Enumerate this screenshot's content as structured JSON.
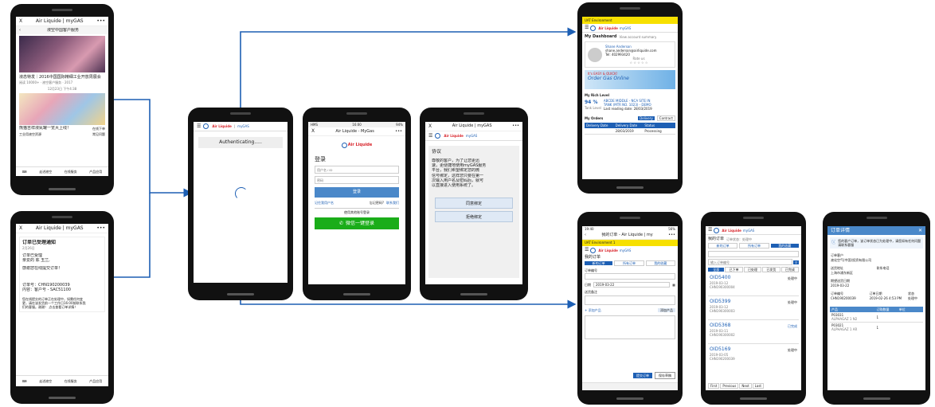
{
  "phone_wechat_news": {
    "close": "X",
    "title": "Air Liquide | myGAS",
    "more": "•••",
    "back": "‹",
    "header": "液空中国客户服务",
    "article1": "液态特发｜2016中国国际精细工业开放周展会",
    "article1_meta": "阅读 10000+ · 液空客户服务 · 2017",
    "date_sep": "12月23日 下午4:38",
    "article2a": "熊猫吉祥液氮罐一览大上线！",
    "article2b": "在线下单",
    "article2c": "工业用液空资源",
    "article2d": "常见问题",
    "nav1": "走进液空",
    "nav2": "在线服务",
    "nav3": "产品应用"
  },
  "phone_wechat_notice": {
    "close": "X",
    "title": "Air Liquide | myGAS",
    "more": "•••",
    "notice_title": "订单已受理通知",
    "notice_date": "2月26日",
    "p1": "订单已受理",
    "p2": "亲爱的 陈 玉兰,",
    "p3": "感谢您在线提交订单！",
    "p4": "订单号：CHN190200039",
    "p5": "内容：客户号 - SAC51100",
    "p6": "您在线提交的订单正在处理中，如需任何变",
    "p7": "更，请在该发货前一个工作日16:00前联系我",
    "p8": "们的客服。谢谢！ 点击查看订单详情！",
    "nav1": "走进液空",
    "nav2": "在线服务",
    "nav3": "产品应用"
  },
  "phone_auth": {
    "brand": "Air Liquide",
    "sep": "|",
    "app": "myGAS",
    "status": "Authenticating....."
  },
  "phone_login": {
    "status_left": "HMS",
    "status_time": "16:00",
    "status_right": "94%",
    "close": "X",
    "title": "Air Liquide - MyGas",
    "more": "•••",
    "brand": "Air Liquide",
    "heading": "登录",
    "user_placeholder": "用户名 / ID",
    "pass_placeholder": "密码",
    "login_button": "登录",
    "remember": "记住我用户名",
    "forgot": "忘记密码?",
    "help": "联系我们",
    "other_login": "使用其他账号登录",
    "wechat_login": "微信一键登录"
  },
  "phone_agreement": {
    "close": "X",
    "title": "Air Liquide | myGAS",
    "more": "•••",
    "brand": "Air Liquide",
    "app": "myGAS",
    "heading": "协议",
    "line1": "尊敬的客户，为了让您更迅",
    "line2": "速，更便捷地使用myGAS服务",
    "line3": "平台，我们希望绑定您的微",
    "line4": "信号绑定，这样您只要在第一",
    "line5": "次输入用户名及密码后，就可",
    "line6": "以直接进入使用系统了。",
    "agree": "同意绑定",
    "refuse": "拒绝绑定"
  },
  "phone_dashboard": {
    "banner": "UAT Environment",
    "brand": "Air Liquide",
    "app": "myGAS",
    "page_title": "My Dashboard",
    "view_link": "View account summary",
    "user_name": "Shane Anderson",
    "user_email": "shane.anderson@airliquide.com",
    "user_tel": "Tel: 402993420",
    "rate_label": "Rate us",
    "rate_stars": "☆ ☆ ☆ ☆ ☆",
    "promo_line1": "It's EASY & QUICK!",
    "promo_line2": "Order Gas Online",
    "rich_level": "My Rich Level",
    "level_pct": "94 %",
    "level_caption": "Tank Level",
    "level_desc1": "ABCDE MIDDLE - NCA SITE IN",
    "level_desc2": "TANK (MTR NO. 1023) - DEMO",
    "level_desc3": "Last reading date: 28/03/2019",
    "orders_title": "My Orders",
    "tab_delivery": "Delivery",
    "tab_contract": "Contract",
    "col1": "Delivery Date",
    "col2": "Delivery Date",
    "col3": "Status",
    "row_date": "28/03/2019",
    "row_status": "Processing"
  },
  "phone_order_form": {
    "status_left": "19:40",
    "status_right": "56%",
    "back": "‹",
    "title": "我的订单 - Air Liquide | my",
    "more": "•••",
    "banner": "UAT Environment 1",
    "brand": "Air Liquide",
    "app": "myGAS",
    "heading": "我的订单",
    "tab1": "新的订单",
    "tab2": "所有订单",
    "tab3": "我的收藏",
    "section": "订单编号",
    "date_label": "日期",
    "date_value": "2019-03-22",
    "notes_label": "送货备注",
    "add_product": "+ 添加产品",
    "add_button": "添加产品",
    "submit": "提交订单",
    "save": "保存草稿"
  },
  "phone_order_list": {
    "brand": "Air Liquide",
    "app": "myGAS",
    "heading": "我的订单",
    "sub": "订单状态：处理中",
    "tab1": "新的订单",
    "tab2": "所有订单",
    "tab3": "我的收藏",
    "search_placeholder": "输入订单编号",
    "f1": "全部",
    "f2": "已下单",
    "f3": "已处理",
    "f4": "已发货",
    "f5": "已完成",
    "orders": [
      {
        "id": "OID5400",
        "date": "2019-03-12",
        "num": "CHN190300004",
        "status": "处理中"
      },
      {
        "id": "OID5399",
        "date": "2019-03-12",
        "num": "CHN190300003",
        "status": "处理中"
      },
      {
        "id": "OID5368",
        "date": "2019-03-11",
        "num": "CHN190300002",
        "status": "已完成"
      },
      {
        "id": "OID5169",
        "date": "2019-03-05",
        "num": "CHN190200039",
        "status": "处理中"
      }
    ],
    "first": "First",
    "prev": "Previous",
    "next": "Next",
    "last": "Last"
  },
  "phone_order_detail": {
    "title": "订单详情",
    "close": "✕",
    "note": "您的客户订单，该订单状态已为处理中，请您如有任何问题请联系客服",
    "customer_label": "订单客户",
    "customer_value": "液化空气(中国)投资有限公司",
    "addr_label": "送货地址",
    "addr_value": "上海市浦东新区",
    "phone_label": "联系电话",
    "date_label": "期望送货日期",
    "date_value": "2019-03-22",
    "order_label": "订单编号",
    "order_value": "CHN190200039",
    "created_label": "订单日期",
    "created_value": "2019-02-26 4:53 PM",
    "status_label": "状态",
    "status_value": "处理中",
    "col_product": "产品",
    "col_qty": "订购数量",
    "col_unit": "单位",
    "item1_code": "P03031",
    "item1_desc": "ALPHAGAZ 1 N2",
    "item1_qty": "1",
    "item2_code": "P03021",
    "item2_desc": "ALPHAGAZ 1 AR",
    "item2_qty": "1"
  }
}
